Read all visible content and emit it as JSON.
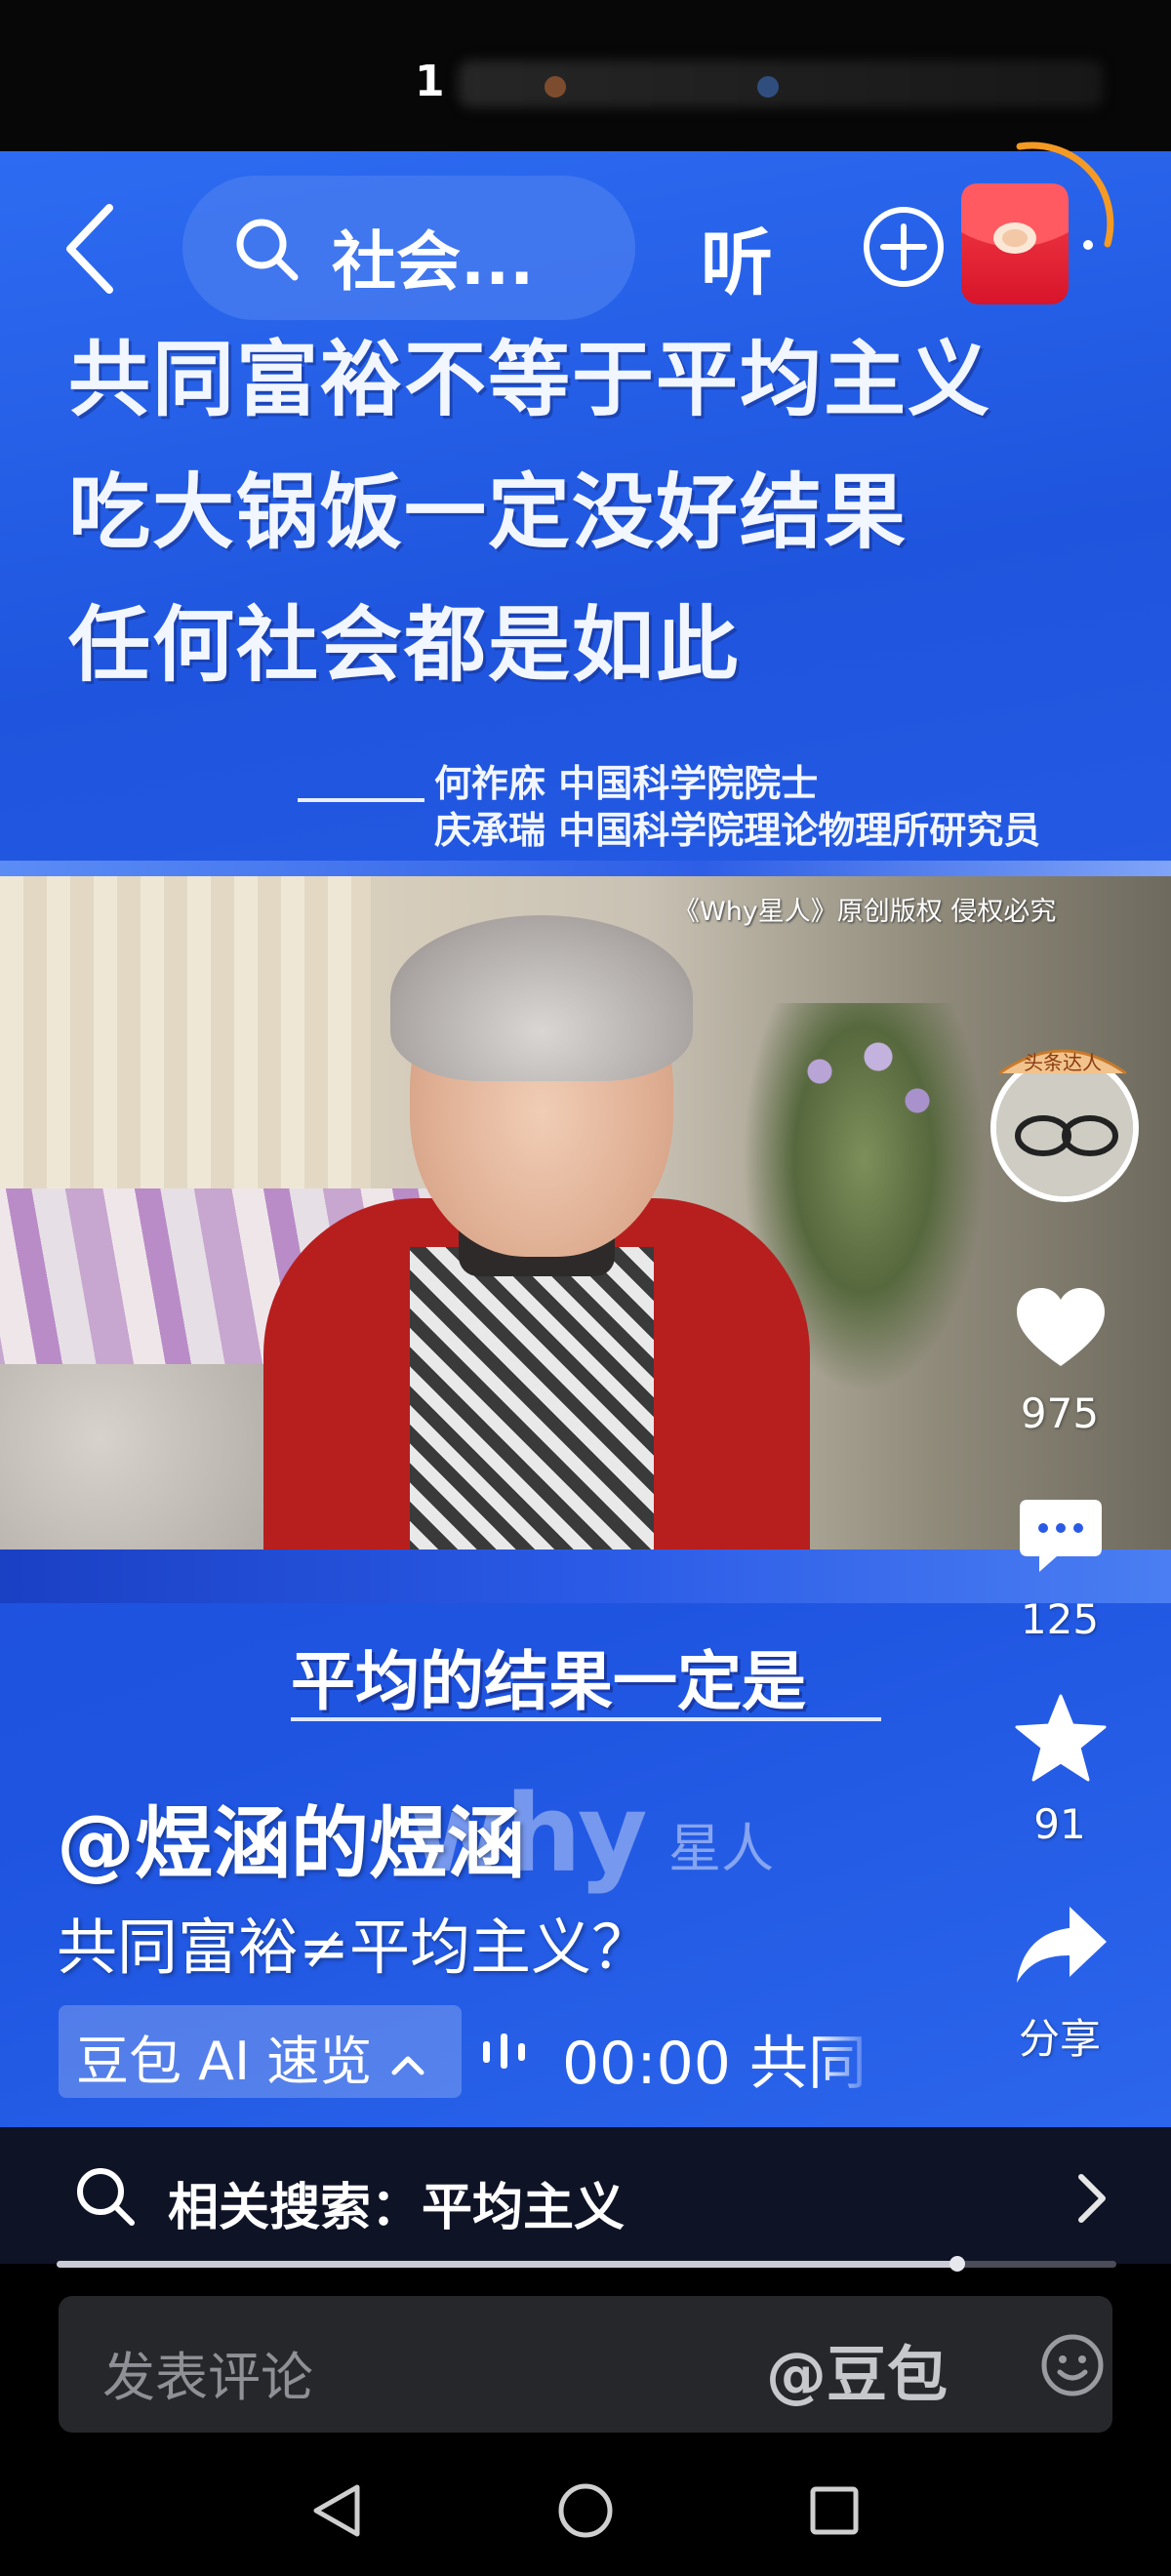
{
  "status_bar": {
    "time": "1"
  },
  "top_bar": {
    "search_text": "社会...",
    "listen_label": "听"
  },
  "video": {
    "headline_lines": [
      "共同富裕不等于平均主义",
      "吃大锅饭一定没好结果",
      "任何社会都是如此"
    ],
    "attribution": [
      "何祚庥 中国科学院院士",
      "庆承瑞 中国科学院理论物理所研究员"
    ],
    "copyright": "《Why星人》原创版权 侵权必究",
    "subtitle": "平均的结果一定是",
    "watermark": "why",
    "watermark_cn": "星人"
  },
  "avatar": {
    "badge_text": "头条达人"
  },
  "actions": {
    "like_count": "975",
    "comment_count": "125",
    "favorite_count": "91",
    "share_label": "分享"
  },
  "post": {
    "author": "@煜涵的煜涵",
    "caption": "共同富裕≠平均主义？",
    "ai_chip_label": "豆包 AI 速览",
    "ai_summary_text": "00:00 共同"
  },
  "related_search": {
    "label": "相关搜索：平均主义"
  },
  "playback": {
    "progress": 0.85
  },
  "comment_bar": {
    "placeholder": "发表评论",
    "mention": "@豆包"
  },
  "colors": {
    "video_blue": "#1f55de",
    "red_packet": "#e2232f",
    "accent_orange": "#f59a23"
  },
  "icons": [
    "back-icon",
    "search-icon",
    "plus-circle-icon",
    "red-packet-icon",
    "heart-icon",
    "comment-icon",
    "star-icon",
    "share-icon",
    "chevron-up-icon",
    "audio-wave-icon",
    "chevron-right-icon",
    "emoji-icon",
    "nav-back-icon",
    "nav-home-icon",
    "nav-recents-icon"
  ]
}
